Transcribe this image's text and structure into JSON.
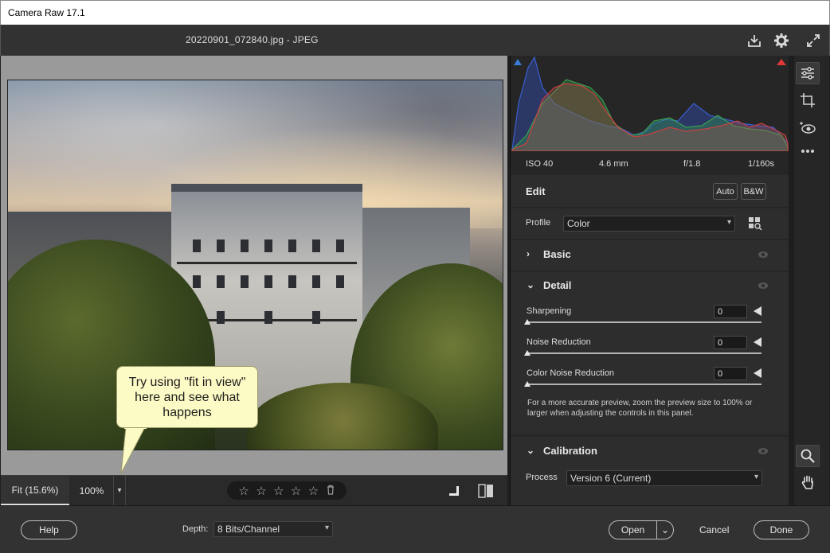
{
  "window": {
    "title": "Camera Raw 17.1"
  },
  "header": {
    "filename": "20220901_072840.jpg  -  JPEG"
  },
  "callout": {
    "text": "Try using \"fit in view\" here and see what happens"
  },
  "preview_bar": {
    "zoom_fit": "Fit (15.6%)",
    "zoom_100": "100%",
    "zoom_dropdown_icon": "chevron-down-icon",
    "rating_stars": [
      "☆",
      "☆",
      "☆",
      "☆",
      "☆"
    ]
  },
  "camera_info": {
    "iso": "ISO 40",
    "focal": "4.6 mm",
    "aperture": "f/1.8",
    "shutter": "1/160s"
  },
  "edit": {
    "title": "Edit",
    "auto_label": "Auto",
    "bw_label": "B&W"
  },
  "profile": {
    "label": "Profile",
    "value": "Color"
  },
  "basic": {
    "title": "Basic"
  },
  "detail": {
    "title": "Detail",
    "sharpening": {
      "label": "Sharpening",
      "value": "0"
    },
    "noise_reduction": {
      "label": "Noise Reduction",
      "value": "0"
    },
    "color_noise_reduction": {
      "label": "Color Noise Reduction",
      "value": "0"
    },
    "note": "For a more accurate preview, zoom the preview size to 100% or larger when adjusting the controls in this panel."
  },
  "calibration": {
    "title": "Calibration",
    "process_label": "Process",
    "process_value": "Version 6 (Current)"
  },
  "footer": {
    "help_label": "Help",
    "depth_label": "Depth:",
    "depth_value": "8 Bits/Channel",
    "open_label": "Open",
    "cancel_label": "Cancel",
    "done_label": "Done"
  },
  "colors": {
    "panel_bg": "#2d2d2d",
    "preview_bg": "#9a9a9a",
    "callout_bg": "#fdfbc5"
  }
}
